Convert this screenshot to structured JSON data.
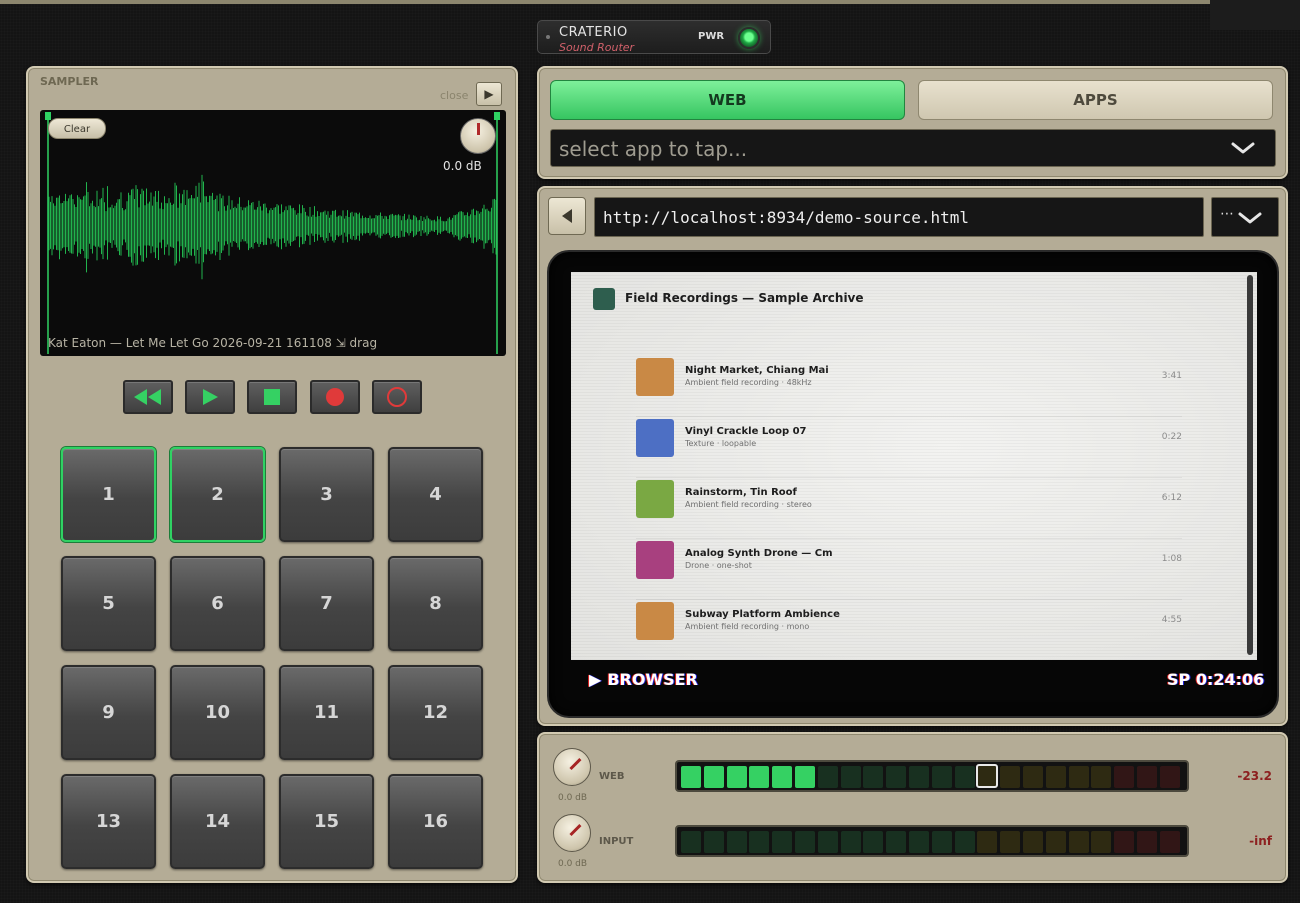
{
  "brand": {
    "name": "CRATERIO",
    "subtitle": "Sound Router",
    "power_label": "PWR"
  },
  "sampler": {
    "title": "SAMPLER",
    "close_label": "close",
    "clear_label": "Clear",
    "gain_db": "0.0 dB",
    "caption": "Kat Eaton — Let Me Let Go 2026-09-21 161108  ⇲ drag",
    "transport": [
      "rewind-icon",
      "play-icon",
      "stop-icon",
      "record-icon",
      "loop-record-icon"
    ],
    "pads": [
      {
        "label": "1",
        "active": true
      },
      {
        "label": "2",
        "active": true
      },
      {
        "label": "3",
        "active": false
      },
      {
        "label": "4",
        "active": false
      },
      {
        "label": "5",
        "active": false
      },
      {
        "label": "6",
        "active": false
      },
      {
        "label": "7",
        "active": false
      },
      {
        "label": "8",
        "active": false
      },
      {
        "label": "9",
        "active": false
      },
      {
        "label": "10",
        "active": false
      },
      {
        "label": "11",
        "active": false
      },
      {
        "label": "12",
        "active": false
      },
      {
        "label": "13",
        "active": false
      },
      {
        "label": "14",
        "active": false
      },
      {
        "label": "15",
        "active": false
      },
      {
        "label": "16",
        "active": false
      }
    ]
  },
  "source": {
    "tabs": [
      {
        "label": "WEB",
        "active": true
      },
      {
        "label": "APPS",
        "active": false
      }
    ],
    "app_select_placeholder": "select app to tap..."
  },
  "browser": {
    "url": "http://localhost:8934/demo-source.html",
    "menu_dots": "⋯",
    "site_title": "Field Recordings — Sample Archive",
    "items": [
      {
        "title": "Night Market, Chiang Mai",
        "subtitle": "Ambient field recording · 48kHz",
        "duration": "3:41",
        "color": "#c98945"
      },
      {
        "title": "Vinyl Crackle Loop 07",
        "subtitle": "Texture · loopable",
        "duration": "0:22",
        "color": "#4d6fc4"
      },
      {
        "title": "Rainstorm, Tin Roof",
        "subtitle": "Ambient field recording · stereo",
        "duration": "6:12",
        "color": "#7aa843"
      },
      {
        "title": "Analog Synth Drone — Cm",
        "subtitle": "Drone · one-shot",
        "duration": "1:08",
        "color": "#a8407f"
      },
      {
        "title": "Subway Platform Ambience",
        "subtitle": "Ambient field recording · mono",
        "duration": "4:55",
        "color": "#c98945"
      }
    ],
    "osd_label": "BROWSER",
    "osd_time": "SP  0:24:06"
  },
  "meters": [
    {
      "name": "WEB",
      "knob_db": "0.0 dB",
      "value": "-23.2",
      "lit_segments": 6,
      "peak_segment": 13
    },
    {
      "name": "INPUT",
      "knob_db": "0.0 dB",
      "value": "-inf",
      "lit_segments": 0,
      "peak_segment": null
    }
  ],
  "colors": {
    "accent_green": "#35d163",
    "panel": "#b4ac96",
    "record_red": "#e03a3a"
  }
}
